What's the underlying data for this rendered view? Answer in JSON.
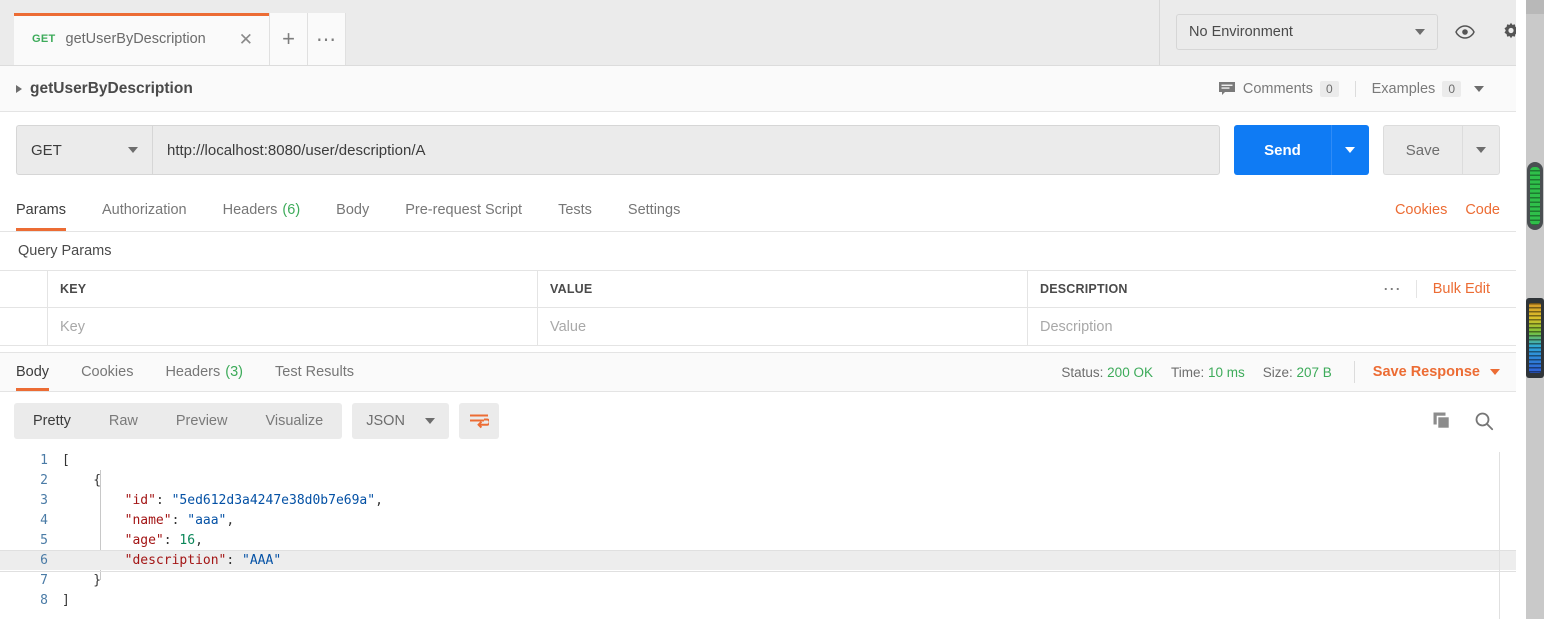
{
  "tab": {
    "method": "GET",
    "title": "getUserByDescription",
    "close_icon": "close-icon",
    "new_tab_icon": "plus-icon",
    "more_icon": "ellipsis-icon"
  },
  "environment": {
    "selected": "No Environment",
    "eye_icon": "eye-icon",
    "gear_icon": "gear-icon"
  },
  "breadcrumb": {
    "title": "getUserByDescription",
    "comments_label": "Comments",
    "comments_count": "0",
    "examples_label": "Examples",
    "examples_count": "0"
  },
  "request": {
    "method": "GET",
    "url": "http://localhost:8080/user/description/A",
    "send_label": "Send",
    "save_label": "Save"
  },
  "request_tabs": [
    {
      "label": "Params",
      "badge": "",
      "active": true
    },
    {
      "label": "Authorization",
      "badge": "",
      "active": false
    },
    {
      "label": "Headers",
      "badge": "(6)",
      "active": false
    },
    {
      "label": "Body",
      "badge": "",
      "active": false
    },
    {
      "label": "Pre-request Script",
      "badge": "",
      "active": false
    },
    {
      "label": "Tests",
      "badge": "",
      "active": false
    },
    {
      "label": "Settings",
      "badge": "",
      "active": false
    }
  ],
  "request_tabs_right": {
    "cookies": "Cookies",
    "code": "Code"
  },
  "query_params": {
    "section_label": "Query Params",
    "columns": [
      "KEY",
      "VALUE",
      "DESCRIPTION"
    ],
    "row_placeholders": [
      "Key",
      "Value",
      "Description"
    ],
    "dots_icon": "ellipsis-icon",
    "bulk_edit": "Bulk Edit"
  },
  "response_tabs": [
    {
      "label": "Body",
      "badge": "",
      "active": true
    },
    {
      "label": "Cookies",
      "badge": "",
      "active": false
    },
    {
      "label": "Headers",
      "badge": "(3)",
      "active": false
    },
    {
      "label": "Test Results",
      "badge": "",
      "active": false
    }
  ],
  "response_meta": {
    "status_label": "Status:",
    "status_value": "200 OK",
    "time_label": "Time:",
    "time_value": "10 ms",
    "size_label": "Size:",
    "size_value": "207 B",
    "save_response": "Save Response"
  },
  "body_toolbar": {
    "views": [
      "Pretty",
      "Raw",
      "Preview",
      "Visualize"
    ],
    "active_view": "Pretty",
    "format": "JSON",
    "wrap_icon": "wrap-lines-icon",
    "copy_icon": "copy-icon",
    "search_icon": "search-icon"
  },
  "response_body": {
    "language": "json",
    "highlighted_line": 6,
    "lines": [
      {
        "n": "1",
        "tokens": [
          {
            "t": "[",
            "c": "p"
          }
        ]
      },
      {
        "n": "2",
        "tokens": [
          {
            "t": "    {",
            "c": "p"
          }
        ]
      },
      {
        "n": "3",
        "tokens": [
          {
            "t": "        ",
            "c": "p"
          },
          {
            "t": "\"id\"",
            "c": "k"
          },
          {
            "t": ": ",
            "c": "p"
          },
          {
            "t": "\"5ed612d3a4247e38d0b7e69a\"",
            "c": "s"
          },
          {
            "t": ",",
            "c": "p"
          }
        ]
      },
      {
        "n": "4",
        "tokens": [
          {
            "t": "        ",
            "c": "p"
          },
          {
            "t": "\"name\"",
            "c": "k"
          },
          {
            "t": ": ",
            "c": "p"
          },
          {
            "t": "\"aaa\"",
            "c": "s"
          },
          {
            "t": ",",
            "c": "p"
          }
        ]
      },
      {
        "n": "5",
        "tokens": [
          {
            "t": "        ",
            "c": "p"
          },
          {
            "t": "\"age\"",
            "c": "k"
          },
          {
            "t": ": ",
            "c": "p"
          },
          {
            "t": "16",
            "c": "n"
          },
          {
            "t": ",",
            "c": "p"
          }
        ]
      },
      {
        "n": "6",
        "tokens": [
          {
            "t": "        ",
            "c": "p"
          },
          {
            "t": "\"description\"",
            "c": "k"
          },
          {
            "t": ": ",
            "c": "p"
          },
          {
            "t": "\"AAA\"",
            "c": "s"
          }
        ]
      },
      {
        "n": "7",
        "tokens": [
          {
            "t": "    }",
            "c": "p"
          }
        ]
      },
      {
        "n": "8",
        "tokens": [
          {
            "t": "]",
            "c": "p"
          }
        ]
      }
    ]
  },
  "colors": {
    "accent_orange": "#ec6c34",
    "send_blue": "#0f7bf4",
    "status_green": "#3dab5a",
    "json_key": "#a31515",
    "json_string": "#0451a5",
    "json_number": "#098658"
  }
}
